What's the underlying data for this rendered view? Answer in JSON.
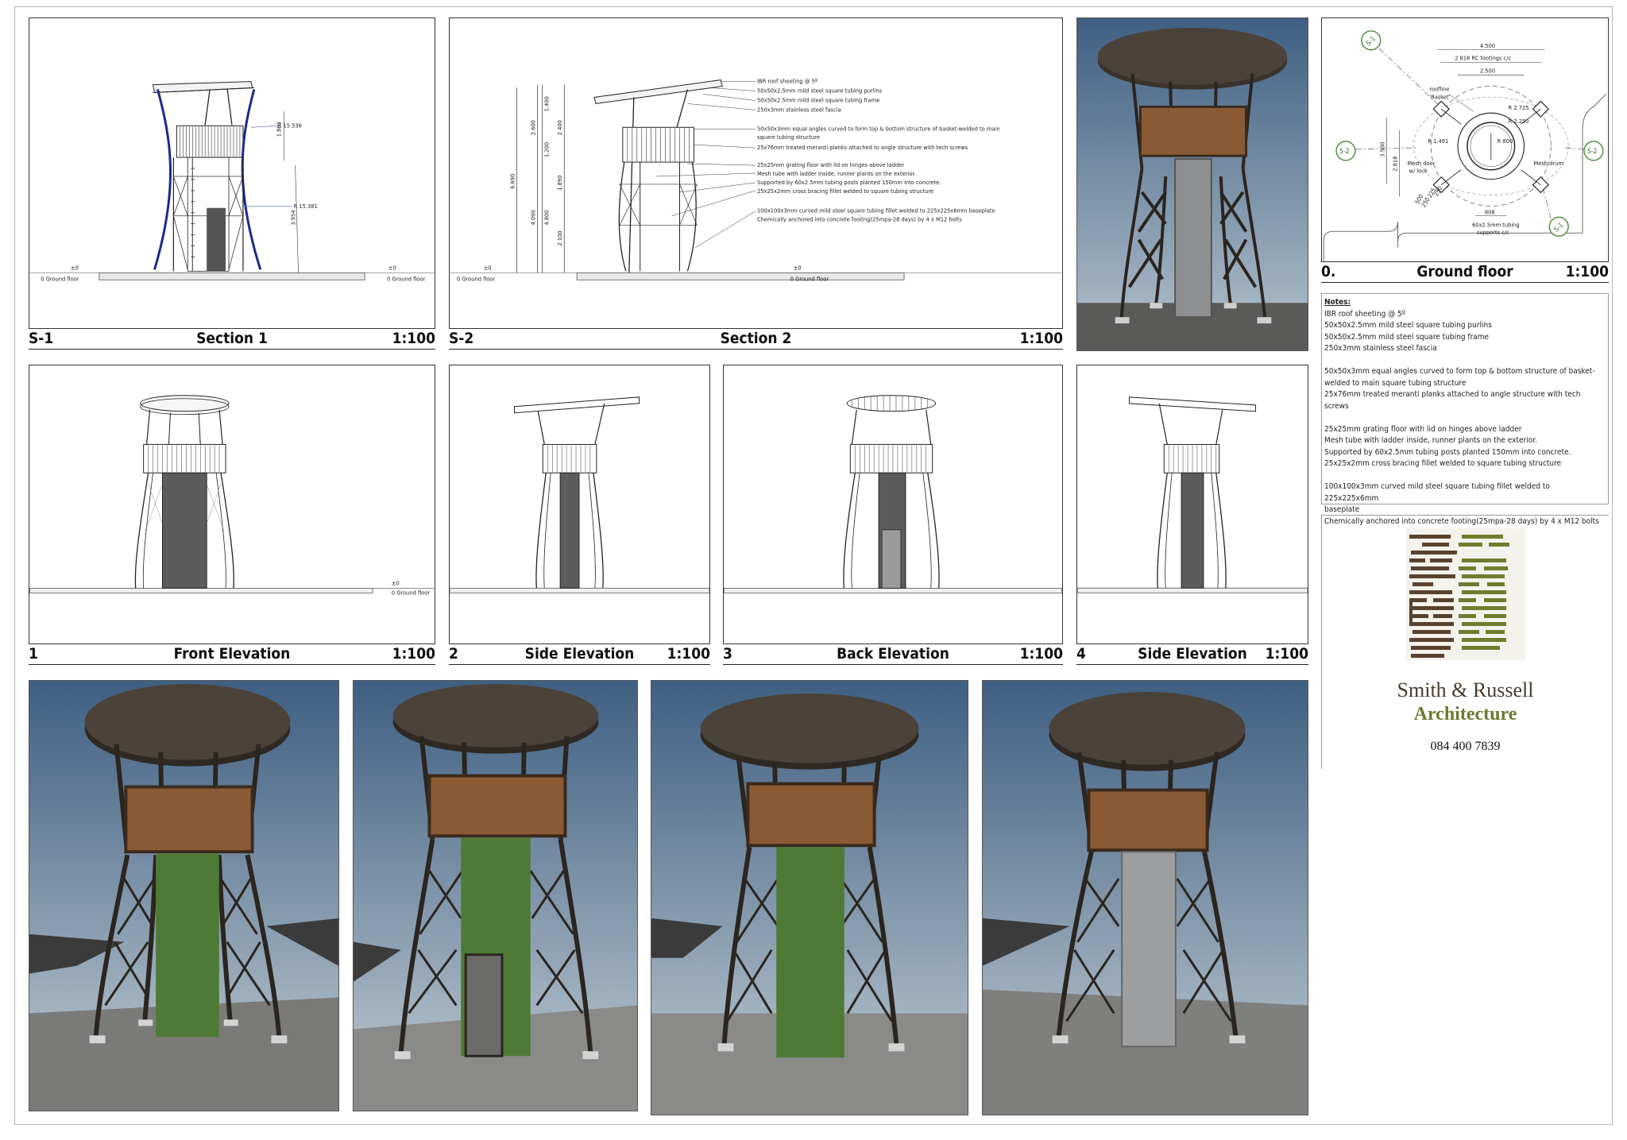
{
  "sheet": {
    "captions": {
      "s1": {
        "num": "S-1",
        "title": "Section 1",
        "scale": "1:100"
      },
      "s2": {
        "num": "S-2",
        "title": "Section 2",
        "scale": "1:100"
      },
      "ground": {
        "num": "0.",
        "title": "Ground floor",
        "scale": "1:100"
      },
      "e1": {
        "num": "1",
        "title": "Front Elevation",
        "scale": "1:100"
      },
      "e2": {
        "num": "2",
        "title": "Side Elevation",
        "scale": "1:100"
      },
      "e3": {
        "num": "3",
        "title": "Back Elevation",
        "scale": "1:100"
      },
      "e4": {
        "num": "4",
        "title": "Side Elevation",
        "scale": "1:100"
      }
    },
    "section1": {
      "dim_a": "1.803",
      "dim_b": "3.954",
      "radius_a": "R 15.536",
      "radius_b": "R 15.381",
      "ground_label_left": "0 Ground floor",
      "ground_label_right": "0 Ground floor",
      "level_mark": "±0"
    },
    "section2": {
      "dims_outer": [
        "6.690"
      ],
      "dims_mid": [
        "2.600",
        "4.090"
      ],
      "dims_col3": [
        "1.400",
        "1.200",
        "4.800"
      ],
      "dims_col4": [
        "2.400",
        "1.890",
        "2.100"
      ],
      "ground_label_left": "0 Ground floor",
      "ground_label_right": "0 Ground floor",
      "level_mark": "±0",
      "annotations": [
        "IBR roof sheeting @ 5º",
        "50x50x2.5mm mild steel square tubing purlins",
        "50x50x2.5mm mild steel square tubing frame",
        "250x3mm stainless steel fascia",
        "50x50x3mm equal angles curved to form top & bottom structure of basket-welded to main",
        "square tubing structure",
        "25x76mm treated meranti planks attached to angle structure with tech screws",
        "25x25mm grating floor with lid on hinges above ladder",
        "Mesh tube with ladder inside, runner plants on the exterior.",
        "Supported by 60x2.5mm tubing posts planted 150mm into concrete.",
        "25x25x2mm cross bracing fillet welded to square tubing structure",
        "100x100x3mm curved mild steel square tubing fillet welded to 225x225x6mm baseplate",
        "Chemically anchored into concrete  footing(25mpa-28 days) by 4 x M12 bolts"
      ]
    },
    "ground_floor": {
      "dim_top": "4.500",
      "dim_footings": "2.818  RC footings c/c",
      "dim_inner": "2.500",
      "roofline_label": "roofline",
      "basket_label": "'Basket'",
      "r1": "R 2.725",
      "r2": "R 2.250",
      "r3": "R 1.491",
      "r4": "R 800",
      "dim_v1": "3.500",
      "dim_v2": "2.818",
      "mesh_door": "Mesh door",
      "lock": "w/ lock",
      "mesh_drum": "Mesh drum",
      "dim_808": "808",
      "tubing_label_1": "60x2.5mm tubing",
      "tubing_label_2": "supports c/c",
      "sec_s1": "S-1",
      "sec_s2": "S-2",
      "dim_diag": [
        "500",
        "250",
        "225",
        "250"
      ]
    },
    "notes": {
      "title": "Notes:",
      "groups": [
        [
          "IBR roof sheeting @ 5º",
          "50x50x2.5mm mild steel square tubing purlins",
          "50x50x2.5mm mild steel square tubing frame",
          "250x3mm stainless steel fascia"
        ],
        [
          "50x50x3mm equal angles curved to form top & bottom structure of basket-",
          "welded to main square tubing structure",
          "25x76mm treated meranti planks attached to angle structure with tech screws"
        ],
        [
          "25x25mm grating floor with lid on hinges above ladder",
          "Mesh tube with ladder inside, runner plants on the exterior.",
          "Supported by 60x2.5mm tubing posts planted 150mm into concrete.",
          "25x25x2mm cross bracing fillet welded to square tubing structure"
        ],
        [
          "100x100x3mm curved mild steel square tubing fillet welded to 225x225x6mm",
          "baseplate",
          "Chemically anchored into concrete  footing(25mpa-28 days) by 4 x M12 bolts"
        ]
      ]
    },
    "firm": {
      "name": "Smith & Russell",
      "sub": "Architecture",
      "phone": "084 400 7839"
    },
    "colors": {
      "brown": "#5a4230",
      "green": "#6f7d2d",
      "sky_top": "#3f5f82",
      "sky_bottom": "#b4c2cc",
      "timber": "#8a5a35",
      "steel": "#3b342e",
      "ivy": "#4f7a36",
      "structure_blue": "#1b2a8c"
    }
  }
}
